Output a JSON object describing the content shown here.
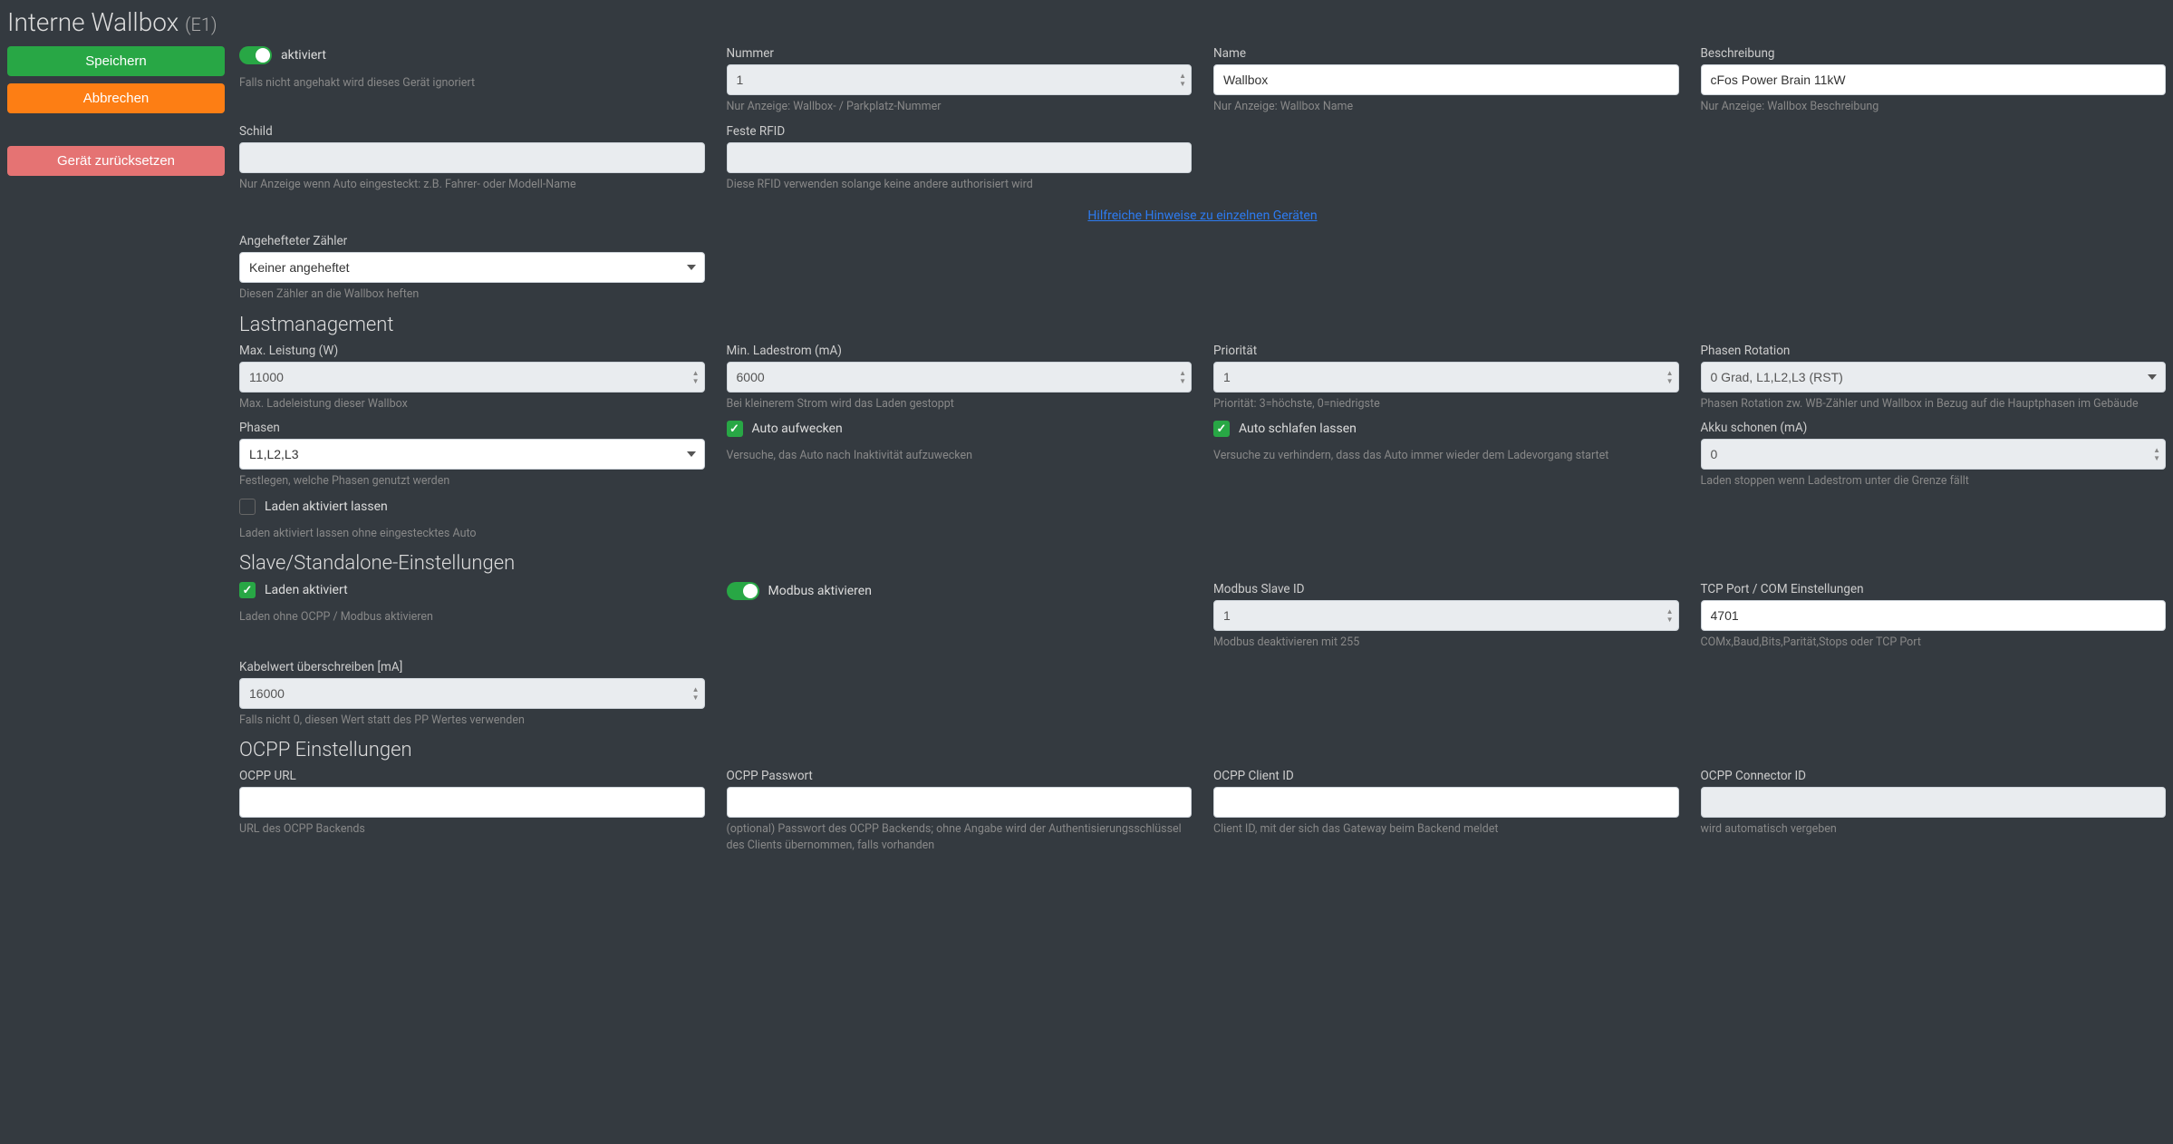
{
  "title": "Interne Wallbox",
  "title_suffix": "(E1)",
  "sidebar": {
    "save": "Speichern",
    "cancel": "Abbrechen",
    "reset": "Gerät zurücksetzen"
  },
  "general": {
    "aktiviert_label": "aktiviert",
    "aktiviert_help": "Falls nicht angehakt wird dieses Gerät ignoriert",
    "nummer_label": "Nummer",
    "nummer_value": "1",
    "nummer_help": "Nur Anzeige: Wallbox- / Parkplatz-Nummer",
    "name_label": "Name",
    "name_value": "Wallbox",
    "name_help": "Nur Anzeige: Wallbox Name",
    "beschreibung_label": "Beschreibung",
    "beschreibung_value": "cFos Power Brain 11kW",
    "beschreibung_help": "Nur Anzeige: Wallbox Beschreibung",
    "schild_label": "Schild",
    "schild_help": "Nur Anzeige wenn Auto eingesteckt: z.B. Fahrer- oder Modell-Name",
    "rfid_label": "Feste RFID",
    "rfid_help": "Diese RFID verwenden solange keine andere authorisiert wird",
    "hints_link": "Hilfreiche Hinweise zu einzelnen Geräten",
    "zaehler_label": "Angehefteter Zähler",
    "zaehler_value": "Keiner angeheftet",
    "zaehler_help": "Diesen Zähler an die Wallbox heften"
  },
  "lastmgmt": {
    "section": "Lastmanagement",
    "max_leistung_label": "Max. Leistung (W)",
    "max_leistung_value": "11000",
    "max_leistung_help": "Max. Ladeleistung dieser Wallbox",
    "min_ladestrom_label": "Min. Ladestrom (mA)",
    "min_ladestrom_value": "6000",
    "min_ladestrom_help": "Bei kleinerem Strom wird das Laden gestoppt",
    "prio_label": "Priorität",
    "prio_value": "1",
    "prio_help": "Priorität: 3=höchste, 0=niedrigste",
    "rotation_label": "Phasen Rotation",
    "rotation_value": "0 Grad, L1,L2,L3 (RST)",
    "rotation_help": "Phasen Rotation zw. WB-Zähler und Wallbox in Bezug auf die Hauptphasen im Gebäude",
    "phasen_label": "Phasen",
    "phasen_value": "L1,L2,L3",
    "phasen_help": "Festlegen, welche Phasen genutzt werden",
    "wakeup_label": "Auto aufwecken",
    "wakeup_help": "Versuche, das Auto nach Inaktivität aufzuwecken",
    "sleep_label": "Auto schlafen lassen",
    "sleep_help": "Versuche zu verhindern, dass das Auto immer wieder dem Ladevorgang startet",
    "akku_label": "Akku schonen (mA)",
    "akku_value": "0",
    "akku_help": "Laden stoppen wenn Ladestrom unter die Grenze fällt",
    "laden_aktiviert_lassen_label": "Laden aktiviert lassen",
    "laden_aktiviert_lassen_help": "Laden aktiviert lassen ohne eingestecktes Auto"
  },
  "slave": {
    "section": "Slave/Standalone-Einstellungen",
    "laden_aktiviert_label": "Laden aktiviert",
    "laden_aktiviert_help": "Laden ohne OCPP / Modbus aktivieren",
    "modbus_label": "Modbus aktivieren",
    "modbus_id_label": "Modbus Slave ID",
    "modbus_id_value": "1",
    "modbus_id_help": "Modbus deaktivieren mit 255",
    "tcp_label": "TCP Port / COM Einstellungen",
    "tcp_value": "4701",
    "tcp_help": "COMx,Baud,Bits,Parität,Stops oder TCP Port",
    "kabel_label": "Kabelwert überschreiben [mA]",
    "kabel_value": "16000",
    "kabel_help": "Falls nicht 0, diesen Wert statt des PP Wertes verwenden"
  },
  "ocpp": {
    "section": "OCPP Einstellungen",
    "url_label": "OCPP URL",
    "url_help": "URL des OCPP Backends",
    "pass_label": "OCPP Passwort",
    "pass_help": "(optional) Passwort des OCPP Backends; ohne Angabe wird der Authentisierungsschlüssel des Clients übernommen, falls vorhanden",
    "client_label": "OCPP Client ID",
    "client_help": "Client ID, mit der sich das Gateway beim Backend meldet",
    "connector_label": "OCPP Connector ID",
    "connector_help": "wird automatisch vergeben"
  }
}
